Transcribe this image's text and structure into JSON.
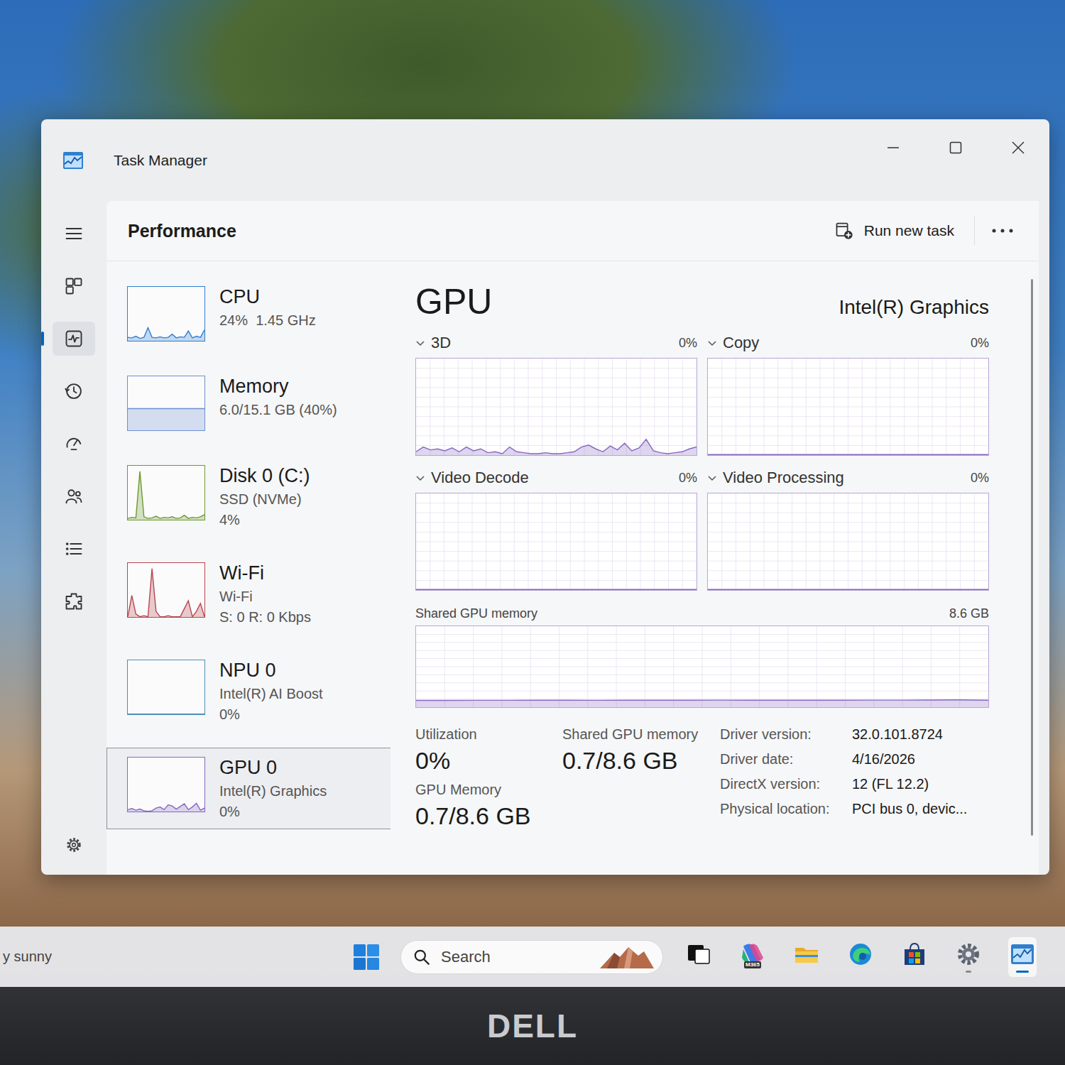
{
  "window": {
    "title": "Task Manager"
  },
  "nav": {
    "items": [
      {
        "selected": false
      },
      {
        "selected": true
      },
      {
        "selected": false
      },
      {
        "selected": false
      },
      {
        "selected": false
      },
      {
        "selected": false
      },
      {
        "selected": false
      }
    ]
  },
  "header": {
    "title": "Performance",
    "run_task": "Run new task"
  },
  "resources": [
    {
      "name": "CPU",
      "lines": [
        "24%  1.45 GHz"
      ],
      "selected": false,
      "color": "#2f7fcf",
      "series": [
        6,
        5,
        8,
        4,
        6,
        24,
        6,
        5,
        7,
        5,
        6,
        12,
        5,
        7,
        6,
        18,
        5,
        8,
        6,
        20
      ]
    },
    {
      "name": "Memory",
      "lines": [
        "6.0/15.1 GB (40%)"
      ],
      "selected": false,
      "color": "#6e8fcf",
      "series": [
        40,
        40,
        40,
        40,
        40,
        40,
        40,
        40,
        40,
        40,
        40,
        40,
        40,
        40,
        40,
        40,
        40,
        40,
        40,
        40
      ]
    },
    {
      "name": "Disk 0 (C:)",
      "lines": [
        "SSD (NVMe)",
        "4%"
      ],
      "selected": false,
      "color": "#6b9a2e",
      "series": [
        2,
        4,
        3,
        90,
        5,
        2,
        3,
        6,
        2,
        4,
        3,
        5,
        2,
        3,
        8,
        2,
        4,
        3,
        5,
        9
      ]
    },
    {
      "name": "Wi-Fi",
      "lines": [
        "Wi-Fi",
        "S: 0 R: 0 Kbps"
      ],
      "selected": false,
      "color": "#b8474e",
      "series": [
        0,
        40,
        5,
        0,
        2,
        0,
        90,
        10,
        0,
        0,
        2,
        0,
        0,
        0,
        15,
        30,
        0,
        10,
        25,
        0
      ]
    },
    {
      "name": "NPU 0",
      "lines": [
        "Intel(R) AI Boost",
        "0%"
      ],
      "selected": false,
      "color": "#4a8fb8",
      "series": [
        0,
        0,
        0,
        0,
        0,
        0,
        0,
        0,
        0,
        0,
        0,
        0,
        0,
        0,
        0,
        0,
        0,
        0,
        0,
        0
      ]
    },
    {
      "name": "GPU 0",
      "lines": [
        "Intel(R) Graphics",
        "0%"
      ],
      "selected": true,
      "color": "#8867c1",
      "series": [
        3,
        5,
        2,
        4,
        1,
        0,
        1,
        6,
        8,
        3,
        12,
        10,
        4,
        9,
        14,
        3,
        8,
        15,
        2,
        6
      ]
    }
  ],
  "detail": {
    "title": "GPU",
    "adapter": "Intel(R) Graphics",
    "engines": [
      {
        "label": "3D",
        "value": "0%",
        "series": [
          3,
          8,
          5,
          6,
          4,
          7,
          3,
          8,
          4,
          6,
          2,
          3,
          1,
          8,
          3,
          2,
          1,
          1,
          2,
          1,
          1,
          2,
          3,
          8,
          10,
          6,
          3,
          9,
          5,
          12,
          4,
          7,
          16,
          4,
          2,
          1,
          2,
          3,
          6,
          8
        ]
      },
      {
        "label": "Copy",
        "value": "0%",
        "series": [
          0,
          0,
          0,
          0,
          0,
          0,
          0,
          0,
          0,
          0,
          0,
          0,
          0,
          0,
          0,
          0,
          0,
          0,
          0,
          0
        ]
      },
      {
        "label": "Video Decode",
        "value": "0%",
        "series": [
          0,
          0,
          0,
          0,
          0,
          0,
          0,
          0,
          0,
          0,
          0,
          0,
          0,
          0,
          0,
          0,
          0,
          0,
          0,
          0
        ]
      },
      {
        "label": "Video Processing",
        "value": "0%",
        "series": [
          0,
          0,
          0,
          0,
          0,
          0,
          0,
          0,
          0,
          0,
          0,
          0,
          0,
          0,
          0,
          0,
          0,
          0,
          0,
          0
        ]
      }
    ],
    "shared_memory_chart": {
      "label": "Shared GPU memory",
      "max": "8.6 GB",
      "series": [
        0.68,
        0.68,
        0.69,
        0.69,
        0.7,
        0.7,
        0.69,
        0.7,
        0.7,
        0.7,
        0.71,
        0.7,
        0.7,
        0.7,
        0.7,
        0.71,
        0.71,
        0.72,
        0.74,
        0.7
      ]
    },
    "stats": [
      {
        "label": "Utilization",
        "value": "0%"
      },
      {
        "label": "Shared GPU memory",
        "value": "0.7/8.6 GB"
      },
      {
        "label": "GPU Memory",
        "value": "0.7/8.6 GB"
      }
    ],
    "properties": [
      {
        "label": "Driver version:",
        "value": "32.0.101.8724"
      },
      {
        "label": "Driver date:",
        "value": "4/16/2026"
      },
      {
        "label": "DirectX version:",
        "value": "12 (FL 12.2)"
      },
      {
        "label": "Physical location:",
        "value": "PCI bus 0, devic..."
      }
    ]
  },
  "taskbar": {
    "weather": "y sunny",
    "search": "Search",
    "apps": [
      {
        "running": false,
        "active": false
      },
      {
        "running": false,
        "active": false,
        "badge": "M365"
      },
      {
        "running": false,
        "active": false
      },
      {
        "running": false,
        "active": false
      },
      {
        "running": false,
        "active": false
      },
      {
        "running": true,
        "active": false
      },
      {
        "running": true,
        "active": true
      }
    ]
  },
  "bezel": {
    "logo": "DELL"
  }
}
